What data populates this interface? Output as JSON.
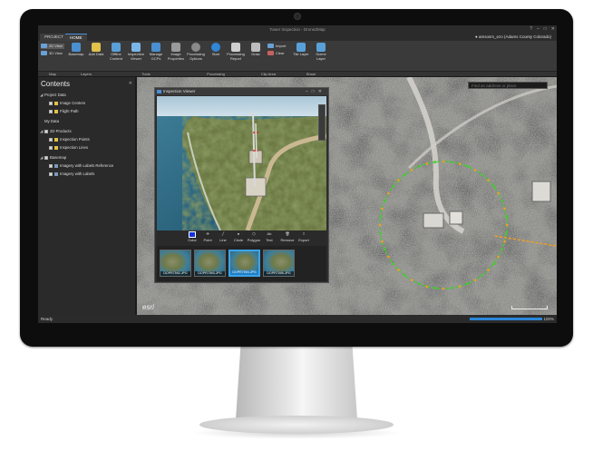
{
  "window": {
    "title": "Tower Inspection - DroneZMap"
  },
  "tabs": [
    {
      "label": "PROJECT"
    },
    {
      "label": "HOME"
    }
  ],
  "user": {
    "label": "amsosm_ezo (Adams County Colorado)"
  },
  "ribbon": {
    "view_2d": "2D View",
    "view_3d": "3D View",
    "buttons": [
      {
        "label": "Basemap"
      },
      {
        "label": "Add Data"
      },
      {
        "label": "Offline Content"
      },
      {
        "label": "Inspection Viewer"
      },
      {
        "label": "Manage GCPs"
      },
      {
        "label": "Image Properties"
      },
      {
        "label": "Processing Options"
      },
      {
        "label": "Start"
      },
      {
        "label": "Processing Report"
      },
      {
        "label": "Draw"
      },
      {
        "label": "Tile Layer"
      },
      {
        "label": "Scene Layer"
      }
    ],
    "import_label": "Import",
    "clear_label": "Clear",
    "groups": [
      "Map",
      "Layers",
      "Tools",
      "Processing",
      "Clip Area",
      "Share"
    ]
  },
  "contents": {
    "title": "Contents",
    "items": [
      {
        "label": "Project Data"
      },
      {
        "label": "Image Centers"
      },
      {
        "label": "Flight Path"
      },
      {
        "label": "My Data"
      },
      {
        "label": "2D Products"
      },
      {
        "label": "Inspection Points"
      },
      {
        "label": "Inspection Lines"
      },
      {
        "label": "Basemap"
      },
      {
        "label": "Imagery with Labels Reference"
      },
      {
        "label": "Imagery with Labels"
      }
    ]
  },
  "map": {
    "search_placeholder": "Find an address or place",
    "logo": "esri",
    "colors": {
      "flight_path": "#3ecf2a",
      "path_point": "#f0a020"
    }
  },
  "viewer": {
    "title": "Inspection Viewer",
    "tools": [
      {
        "label": "Color"
      },
      {
        "label": "Point"
      },
      {
        "label": "Line"
      },
      {
        "label": "Circle"
      },
      {
        "label": "Polygon"
      },
      {
        "label": "Text"
      },
      {
        "label": "Remove"
      },
      {
        "label": "Export"
      }
    ],
    "thumbnails": [
      {
        "label": "DOPR7592.JPG"
      },
      {
        "label": "DOPR7593.JPG"
      },
      {
        "label": "DOPR7594.JPG"
      },
      {
        "label": "DOPR7595.JPG"
      }
    ],
    "selected_thumbnail": 2
  },
  "status": {
    "text": "Ready",
    "progress_text": "100%",
    "progress": 1.0
  }
}
